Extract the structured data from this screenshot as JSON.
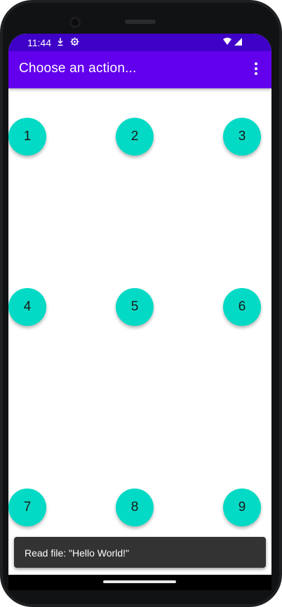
{
  "status_bar": {
    "time": "11:44",
    "icons": [
      "download-icon",
      "settings-gear-icon",
      "wifi-icon",
      "signal-icon"
    ],
    "background": "#3f00c7"
  },
  "app_bar": {
    "title": "Choose an action...",
    "background": "#6200ee",
    "menu_icon": "overflow-menu-icon"
  },
  "buttons": [
    {
      "label": "1"
    },
    {
      "label": "2"
    },
    {
      "label": "3"
    },
    {
      "label": "4"
    },
    {
      "label": "5"
    },
    {
      "label": "6"
    },
    {
      "label": "7"
    },
    {
      "label": "8"
    },
    {
      "label": "9"
    }
  ],
  "button_color": "#03dac5",
  "snackbar": {
    "message": "Read file: \"Hello World!\""
  }
}
